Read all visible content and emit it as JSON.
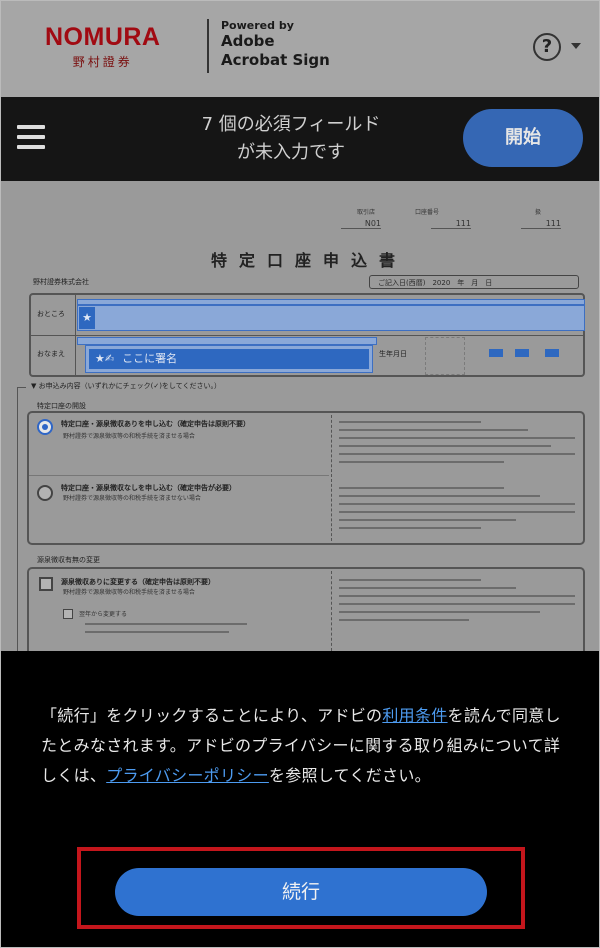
{
  "header": {
    "logo_main": "NOMURA",
    "logo_sub": "野村證券",
    "powered_by": "Powered by",
    "product_line1": "Adobe",
    "product_line2": "Acrobat Sign",
    "help_symbol": "?"
  },
  "status": {
    "line1": "7 個の必須フィールド",
    "line2": "が未入力です",
    "start_label": "開始"
  },
  "document": {
    "meta_labels": [
      "取引店",
      "口座番号",
      "扱"
    ],
    "meta_values": [
      "N01",
      "111",
      "111"
    ],
    "title": "特定口座申込書",
    "company": "野村證券株式会社",
    "date_label": "ご記入日(西暦)　2020　年　月　日",
    "address_label": "おところ",
    "name_label": "おなまえ",
    "sign_here": "ここに署名",
    "birth_label": "生年月日",
    "apply_heading": "▼ お申込み内容（いずれかにチェック(✓)をしてください。）",
    "section1_label": "特定口座の開設",
    "option1_title": "特定口座・源泉徴収ありを申し込む（確定申告は原則不要）",
    "option1_sub": "野村證券で源泉徴収等の和税手続を済ませる場合",
    "option2_title": "特定口座・源泉徴収なしを申し込む（確定申告が必要）",
    "option2_sub": "野村證券で源泉徴収等の和税手続を済ませない場合",
    "section2_label": "源泉徴収有無の変更",
    "option3_title": "源泉徴収ありに変更する（確定申告は原則不要）",
    "option3_sub": "野村證券で源泉徴収等の和税手続を済ませる場合",
    "option4_title": "翌年から変更する"
  },
  "consent": {
    "text_before_terms": "「続行」をクリックすることにより、アドビの",
    "terms_link": "利用条件",
    "text_after_terms": "を読んで同意したとみなされます。アドビのプライバシーに関する取り組みについて詳しくは、",
    "privacy_link": "プライバシーポリシー",
    "text_end": "を参照してください。",
    "continue_label": "続行"
  },
  "colors": {
    "accent_blue": "#2f72d0",
    "highlight_red": "#c4161c",
    "link_blue": "#4d9bf0",
    "brand_red": "#a10a12"
  }
}
